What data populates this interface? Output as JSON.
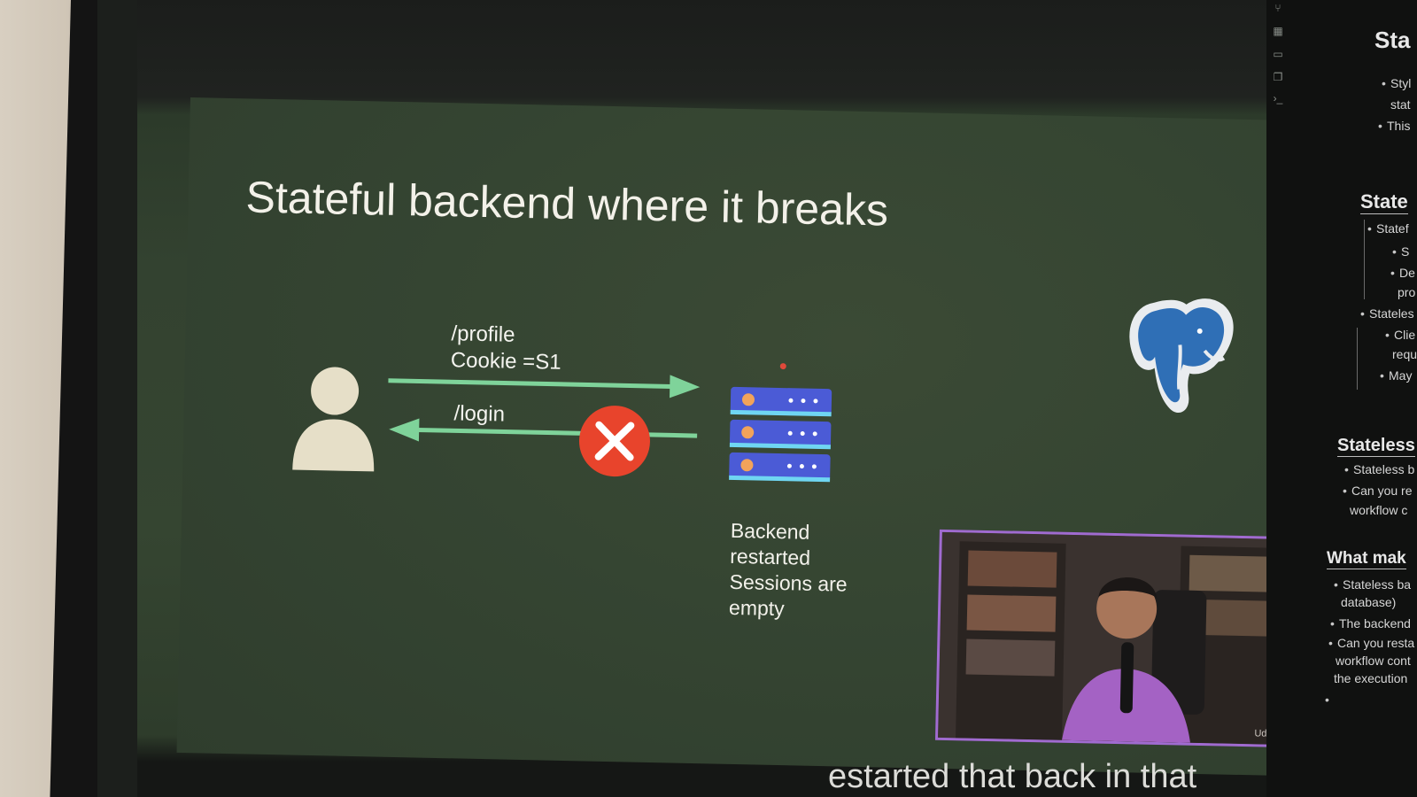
{
  "slide": {
    "title": "Stateful backend where it breaks",
    "request_label_line1": "/profile",
    "request_label_line2": "Cookie =S1",
    "response_label": "/login",
    "server_note_lines": [
      "Backend",
      "restarted",
      "Sessions are",
      "empty"
    ]
  },
  "icons": {
    "user": "user-icon",
    "server": "server-stack-icon",
    "error": "error-x-icon",
    "database": "postgresql-elephant-icon"
  },
  "colors": {
    "arrow": "#7fd39a",
    "error_red": "#e8442c",
    "server_blue": "#4b5bd6",
    "server_stripe": "#6fd6f2",
    "webcam_border": "#a06bd0",
    "slide_bg": "#354532",
    "postgres_blue": "#2f6fb6"
  },
  "webcam": {
    "watermark": "Udemy"
  },
  "caption": {
    "text": "estarted that back in that"
  },
  "notes_panel": {
    "section1": {
      "heading": "Sta",
      "items": [
        "Styl",
        "stat",
        "This"
      ]
    },
    "section2": {
      "heading": "State",
      "items": [
        "Statef",
        "S",
        "De",
        "pro",
        "Stateles",
        "Clie",
        "requ",
        "May"
      ]
    },
    "section3": {
      "heading": "Stateless",
      "items": [
        "Stateless b",
        "Can you re",
        "workflow c"
      ]
    },
    "section4": {
      "heading": "What mak",
      "items": [
        "Stateless ba",
        "database)",
        "The backend",
        "Can you resta",
        "workflow cont",
        "the execution"
      ]
    }
  }
}
